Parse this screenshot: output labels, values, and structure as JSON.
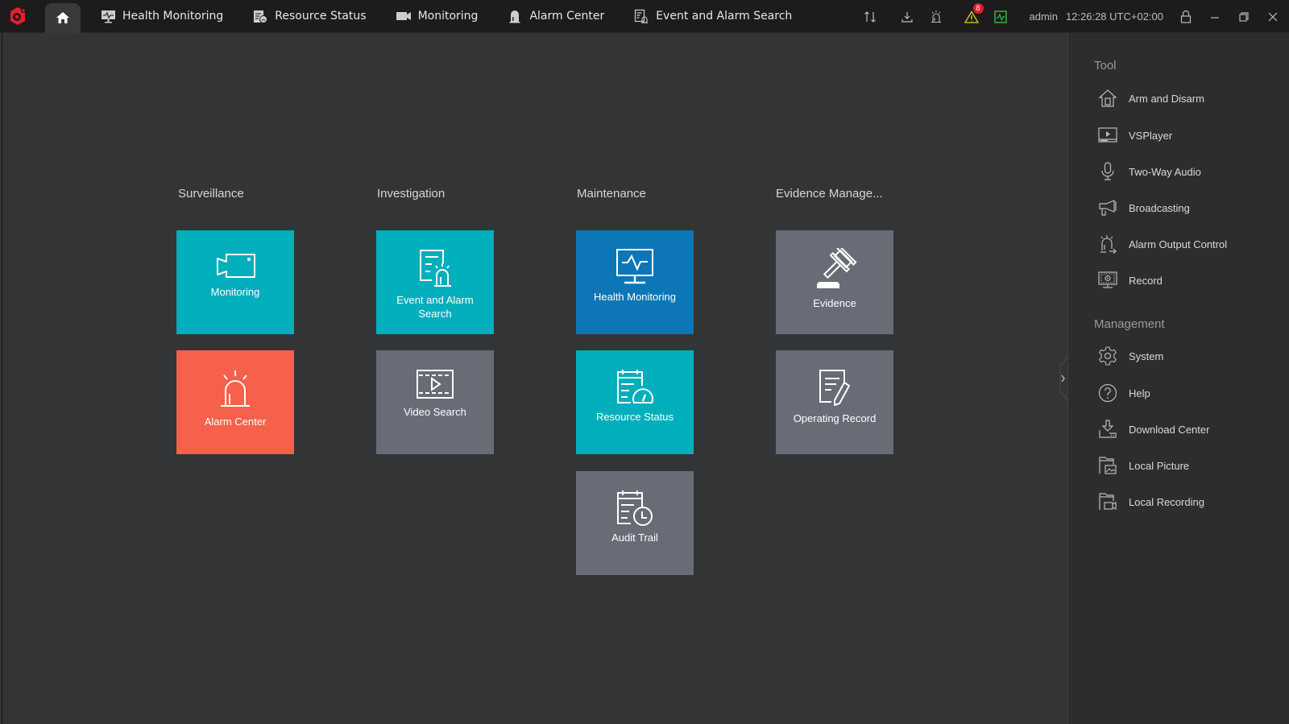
{
  "topbar": {
    "home_label": "Home",
    "tabs": [
      {
        "label": "Health Monitoring",
        "icon": "health-monitor-icon"
      },
      {
        "label": "Resource Status",
        "icon": "resource-status-icon"
      },
      {
        "label": "Monitoring",
        "icon": "camera-icon"
      },
      {
        "label": "Alarm Center",
        "icon": "alarm-icon"
      },
      {
        "label": "Event and Alarm Search",
        "icon": "event-search-icon"
      }
    ],
    "alert_count": "8",
    "user": "admin",
    "clock": "12:26:28 UTC+02:00"
  },
  "groups": [
    {
      "title": "Surveillance"
    },
    {
      "title": "Investigation"
    },
    {
      "title": "Maintenance"
    },
    {
      "title": "Evidence Manage..."
    }
  ],
  "tiles": {
    "monitoring": "Monitoring",
    "alarm_center": "Alarm Center",
    "event_alarm_search": "Event and Alarm Search",
    "video_search": "Video Search",
    "health_monitoring": "Health Monitoring",
    "resource_status": "Resource Status",
    "audit_trail": "Audit Trail",
    "evidence": "Evidence",
    "operating_record": "Operating Record"
  },
  "colors": {
    "teal": "#00aebc",
    "red": "#f5614b",
    "blue": "#0d76b6",
    "grey": "#676c76",
    "brand": "#e0212b"
  },
  "panel": {
    "tool_title": "Tool",
    "tools": [
      "Arm and Disarm",
      "VSPlayer",
      "Two-Way Audio",
      "Broadcasting",
      "Alarm Output Control",
      "Record"
    ],
    "management_title": "Management",
    "management": [
      "System",
      "Help",
      "Download Center",
      "Local Picture",
      "Local Recording"
    ]
  }
}
